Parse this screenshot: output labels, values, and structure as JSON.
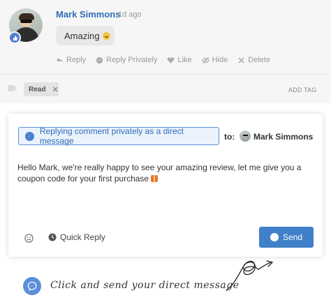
{
  "comment": {
    "author": "Mark Simmons",
    "time": "1d ago",
    "text": "Amazing",
    "actions": {
      "reply": "Reply",
      "reply_privately": "Reply Privately",
      "like": "Like",
      "hide": "Hide",
      "delete": "Delete"
    }
  },
  "tags": {
    "items": [
      {
        "label": "Read"
      }
    ],
    "add_label": "ADD TAG"
  },
  "composer": {
    "mode_label": "Replying comment privately as a direct message",
    "to_label": "to:",
    "recipient": "Mark Simmons",
    "message": "Hello Mark, we're really happy to see your amazing review, let me give you a coupon code for your first purchase",
    "quick_reply_label": "Quick Reply",
    "send_label": "Send"
  },
  "annotation": {
    "text": "Click and send  your direct message"
  },
  "colors": {
    "accent": "#3f80c9",
    "author_link": "#2f6db5",
    "background": "#f6f6f6"
  },
  "icons": [
    "reply-icon",
    "reply-privately-icon",
    "like-icon",
    "hide-icon",
    "delete-icon",
    "tag-icon",
    "messenger-icon",
    "emoji-icon",
    "clock-icon"
  ]
}
